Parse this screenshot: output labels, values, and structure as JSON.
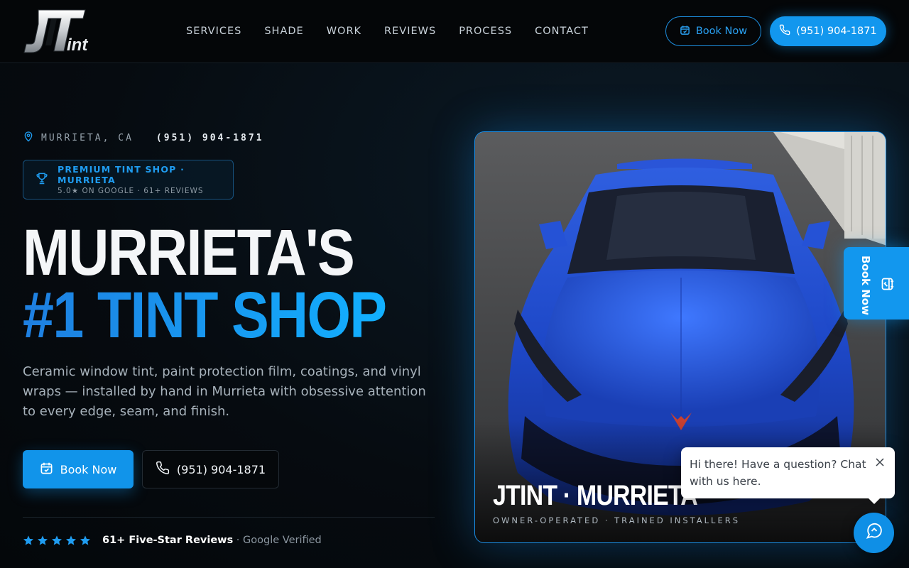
{
  "brand": {
    "logo_text_main": "JT",
    "logo_text_sub": "int"
  },
  "nav": {
    "items": [
      {
        "label": "SERVICES"
      },
      {
        "label": "SHADE"
      },
      {
        "label": "WORK"
      },
      {
        "label": "REVIEWS"
      },
      {
        "label": "PROCESS"
      },
      {
        "label": "CONTACT"
      }
    ]
  },
  "header": {
    "book_label": "Book Now",
    "phone_label": "(951) 904-1871"
  },
  "hero": {
    "location": "MURRIETA, CA",
    "phone": "(951) 904-1871",
    "badge_line1": "PREMIUM TINT SHOP · MURRIETA",
    "badge_line2": "5.0★ ON GOOGLE · 61+ REVIEWS",
    "headline_line1": "MURRIETA'S",
    "headline_line2": "#1 TINT SHOP",
    "description": "Ceramic window tint, paint protection film, coatings, and vinyl wraps — installed by hand in Murrieta with obsessive attention to every edge, seam, and finish.",
    "book_label": "Book Now",
    "call_label": "(951) 904-1871",
    "rating_stars": 5,
    "reviews_bold": "61+ Five-Star Reviews",
    "reviews_rest": " · Google Verified"
  },
  "card": {
    "title": "JTINT · MURRIETA",
    "subtitle": "OWNER-OPERATED · TRAINED INSTALLERS"
  },
  "sidetab": {
    "label": "Book Now"
  },
  "chat": {
    "message": "Hi there! Have a question? Chat with us here."
  },
  "colors": {
    "accent": "#1297ee",
    "background": "#060b10",
    "header": "#040608"
  }
}
